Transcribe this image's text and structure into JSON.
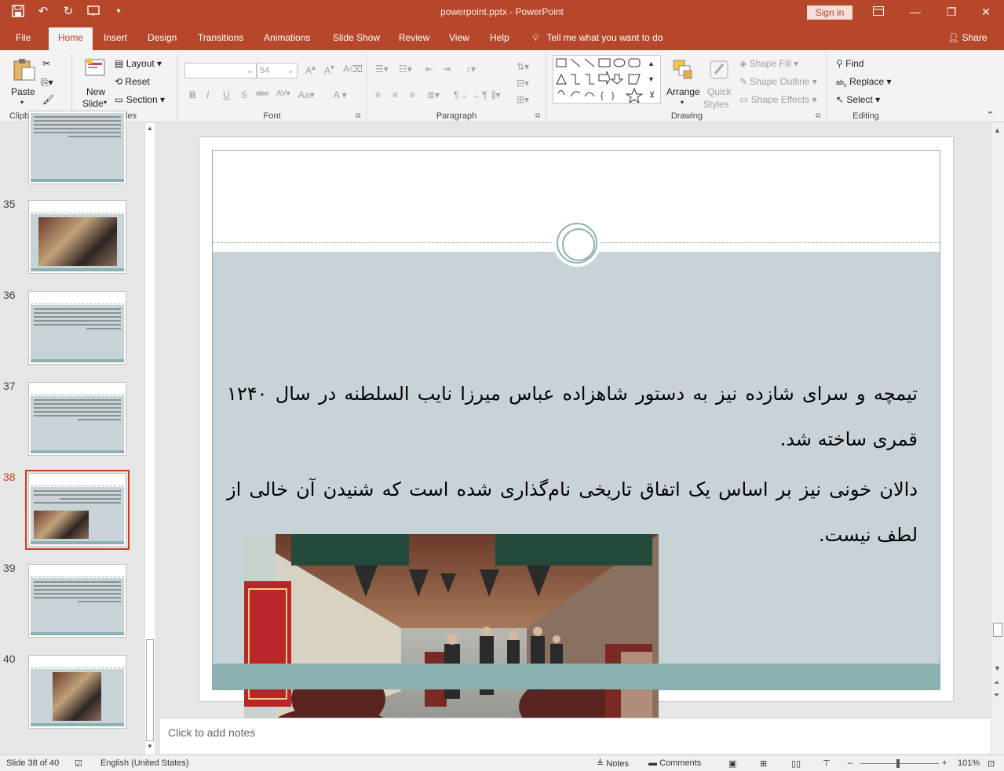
{
  "window": {
    "title": "powerpoint.pptx  -  PowerPoint",
    "sign_in": "Sign in"
  },
  "tabs": [
    "File",
    "Home",
    "Insert",
    "Design",
    "Transitions",
    "Animations",
    "Slide Show",
    "Review",
    "View",
    "Help"
  ],
  "active_tab": "Home",
  "tell_me": "Tell me what you want to do",
  "share": "Share",
  "ribbon": {
    "clipboard": {
      "label": "Clipboard",
      "paste": "Paste"
    },
    "slides": {
      "label": "Slides",
      "new_slide_1": "New",
      "new_slide_2": "Slide",
      "layout": "Layout",
      "reset": "Reset",
      "section": "Section"
    },
    "font": {
      "label": "Font",
      "size": "54"
    },
    "paragraph": {
      "label": "Paragraph"
    },
    "drawing": {
      "label": "Drawing",
      "arrange": "Arrange",
      "quick_1": "Quick",
      "quick_2": "Styles",
      "shape_fill": "Shape Fill",
      "shape_outline": "Shape Outline",
      "shape_effects": "Shape Effects"
    },
    "editing": {
      "label": "Editing",
      "find": "Find",
      "replace": "Replace",
      "select": "Select"
    }
  },
  "thumbnails": [
    {
      "num": "35"
    },
    {
      "num": "36"
    },
    {
      "num": "37"
    },
    {
      "num": "38"
    },
    {
      "num": "39"
    },
    {
      "num": "40"
    }
  ],
  "slide": {
    "paragraph1": "تیمچه و سرای شازده نیز به دستور شاهزاده عباس میرزا نایب السلطنه در سال ۱۲۴۰ قمری ساخته شد.",
    "paragraph2": "دالان خونی نیز بر اساس یک اتفاق تاریخی نام‌گذاری شده است که شنیدن آن خالی از لطف نیست."
  },
  "notes_placeholder": "Click to add notes",
  "status": {
    "slide_info": "Slide 38 of 40",
    "language": "English (United States)",
    "notes": "Notes",
    "comments": "Comments",
    "zoom": "101%"
  },
  "colors": {
    "accent": "#b7472a",
    "slide_body": "#c8d3d8",
    "slide_footer": "#8bb0b0"
  }
}
